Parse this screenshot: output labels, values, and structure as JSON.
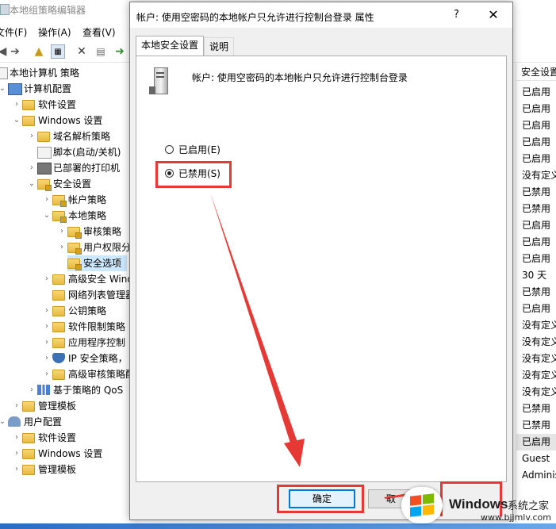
{
  "app": {
    "title": "本地组策略编辑器"
  },
  "menu": [
    "文件(F)",
    "操作(A)",
    "查看(V)"
  ],
  "tree": {
    "root": "本地计算机 策略",
    "computer_config": "计算机配置",
    "software_settings": "软件设置",
    "windows_settings": "Windows 设置",
    "name_resolution": "域名解析策略",
    "scripts": "脚本(启动/关机)",
    "printers": "已部署的打印机",
    "security_settings": "安全设置",
    "account_policies": "帐户策略",
    "local_policies": "本地策略",
    "audit_policy": "审核策略",
    "user_rights": "用户权限分",
    "security_options": "安全选项",
    "advanced_firewall": "高级安全 Wind",
    "network_list": "网络列表管理器",
    "public_key": "公钥策略",
    "software_restriction": "软件限制策略",
    "app_control": "应用程序控制",
    "ipsec": "IP 安全策略，",
    "advanced_audit": "高级审核策略配",
    "qos": "基于策略的 QoS",
    "admin_templates": "管理模板",
    "user_config": "用户配置",
    "user_software": "软件设置",
    "user_windows": "Windows 设置",
    "user_admin": "管理模板"
  },
  "right_column": {
    "header": "安全设置",
    "values": [
      "已启用",
      "已启用",
      "已启用",
      "已启用",
      "已启用",
      "没有定义",
      "已禁用",
      "已禁用",
      "已启用",
      "已启用",
      "已启用",
      "30 天",
      "已禁用",
      "已启用",
      "没有定义",
      "没有定义",
      "没有定义",
      "没有定义",
      "没有定义",
      "已禁用",
      "已禁用",
      "已启用",
      "Guest",
      "Adminis"
    ]
  },
  "dialog": {
    "title": "帐户: 使用空密码的本地帐户只允许进行控制台登录 属性",
    "help": "?",
    "close": "✕",
    "tabs": [
      "本地安全设置",
      "说明"
    ],
    "policy_name": "帐户: 使用空密码的本地帐户只允许进行控制台登录",
    "enabled_label": "已启用(E)",
    "disabled_label": "已禁用(S)",
    "selected": "disabled",
    "ok_label": "确定",
    "cancel_label": "取"
  },
  "watermark": {
    "brand": "Windows",
    "suffix": "系统之家",
    "url": "www.bjjmlv.com"
  },
  "colors": {
    "highlight": "#e53935",
    "accent": "#0078d7"
  }
}
